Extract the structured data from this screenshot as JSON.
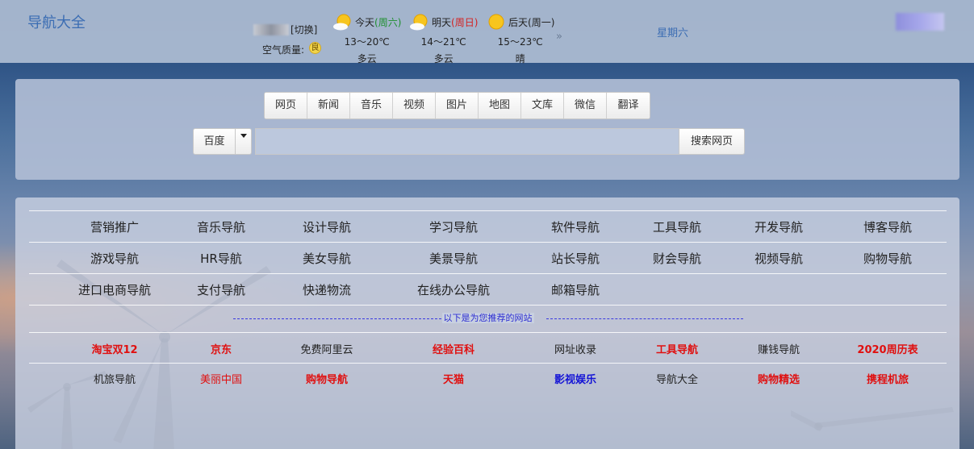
{
  "header": {
    "brand": "导航大全",
    "switch_label": "[切换]",
    "air_quality_label": "空气质量:",
    "air_quality_value": "良",
    "more_icon": "»",
    "weekday": "星期六"
  },
  "weather": [
    {
      "day": "今天",
      "weekday": "(周六)",
      "temp": "13～20℃",
      "cond": "多云",
      "icon": "sun-cloud-icon"
    },
    {
      "day": "明天",
      "weekday": "(周日)",
      "temp": "14～21℃",
      "cond": "多云",
      "icon": "sun-cloud-icon"
    },
    {
      "day": "后天",
      "weekday": "(周一)",
      "temp": "15～23℃",
      "cond": "晴",
      "icon": "sun-icon"
    }
  ],
  "search": {
    "tabs": [
      "网页",
      "新闻",
      "音乐",
      "视频",
      "图片",
      "地图",
      "文库",
      "微信",
      "翻译"
    ],
    "engine": "百度",
    "input_value": "",
    "button": "搜索网页"
  },
  "categories": [
    [
      "营销推广",
      "音乐导航",
      "设计导航",
      "学习导航",
      "软件导航",
      "工具导航",
      "开发导航",
      "博客导航"
    ],
    [
      "游戏导航",
      "HR导航",
      "美女导航",
      "美景导航",
      "站长导航",
      "财会导航",
      "视频导航",
      "购物导航"
    ],
    [
      "进口电商导航",
      "支付导航",
      "快递物流",
      "在线办公导航",
      "邮箱导航"
    ]
  ],
  "recommend_label": "以下是为您推荐的网站",
  "sites": [
    [
      {
        "name": "淘宝双12",
        "style": "red"
      },
      {
        "name": "京东",
        "style": "red"
      },
      {
        "name": "免费阿里云",
        "style": "black"
      },
      {
        "name": "经验百科",
        "style": "red"
      },
      {
        "name": "网址收录",
        "style": "black"
      },
      {
        "name": "工具导航",
        "style": "red"
      },
      {
        "name": "赚钱导航",
        "style": "black"
      },
      {
        "name": "2020周历表",
        "style": "red"
      }
    ],
    [
      {
        "name": "机旅导航",
        "style": "black"
      },
      {
        "name": "美丽中国",
        "style": "red-normal"
      },
      {
        "name": "购物导航",
        "style": "red"
      },
      {
        "name": "天猫",
        "style": "red"
      },
      {
        "name": "影视娱乐",
        "style": "blue"
      },
      {
        "name": "导航大全",
        "style": "black"
      },
      {
        "name": "购物精选",
        "style": "red"
      },
      {
        "name": "携程机旅",
        "style": "red"
      }
    ]
  ],
  "colors": {
    "brand": "#3b6db3",
    "link_red": "#e01010",
    "link_blue": "#1414d6",
    "recommend": "#2d2dd2"
  }
}
